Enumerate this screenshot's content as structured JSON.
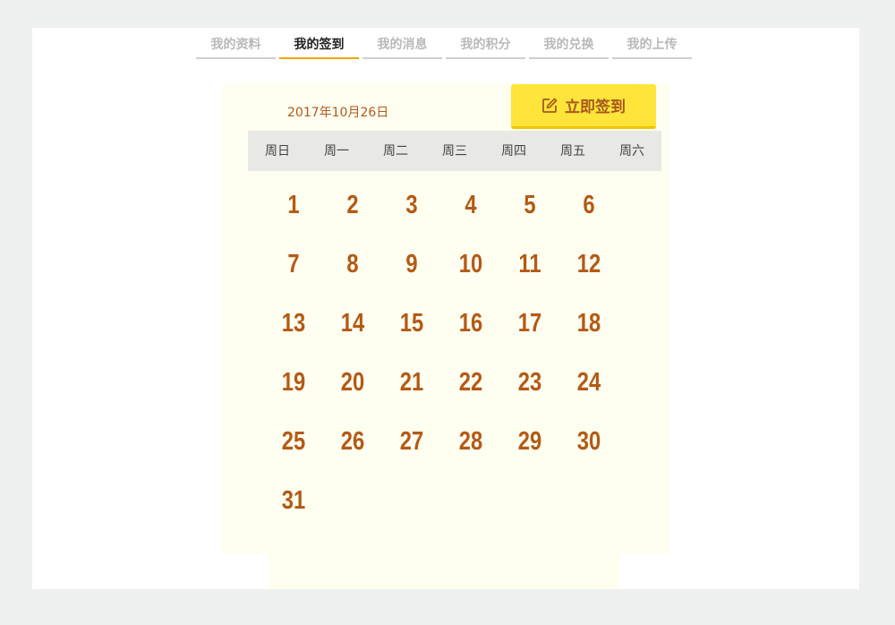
{
  "tabs": [
    {
      "label": "我的资料",
      "active": false
    },
    {
      "label": "我的签到",
      "active": true
    },
    {
      "label": "我的消息",
      "active": false
    },
    {
      "label": "我的积分",
      "active": false
    },
    {
      "label": "我的兑换",
      "active": false
    },
    {
      "label": "我的上传",
      "active": false
    }
  ],
  "calendar": {
    "current_date": "2017年10月26日",
    "signin_button": {
      "label": "立即签到",
      "icon": "edit-icon"
    },
    "weekdays": [
      "周日",
      "周一",
      "周二",
      "周三",
      "周四",
      "周五",
      "周六"
    ],
    "days": [
      "1",
      "2",
      "3",
      "4",
      "5",
      "6",
      "7",
      "8",
      "9",
      "10",
      "11",
      "12",
      "13",
      "14",
      "15",
      "16",
      "17",
      "18",
      "19",
      "20",
      "21",
      "22",
      "23",
      "24",
      "25",
      "26",
      "27",
      "28",
      "29",
      "30",
      "31"
    ]
  },
  "colors": {
    "accent": "#ffe53a",
    "day_text": "#b45a14",
    "active_tab_underline": "#f0a400",
    "calendar_bg": "#fefef1"
  }
}
